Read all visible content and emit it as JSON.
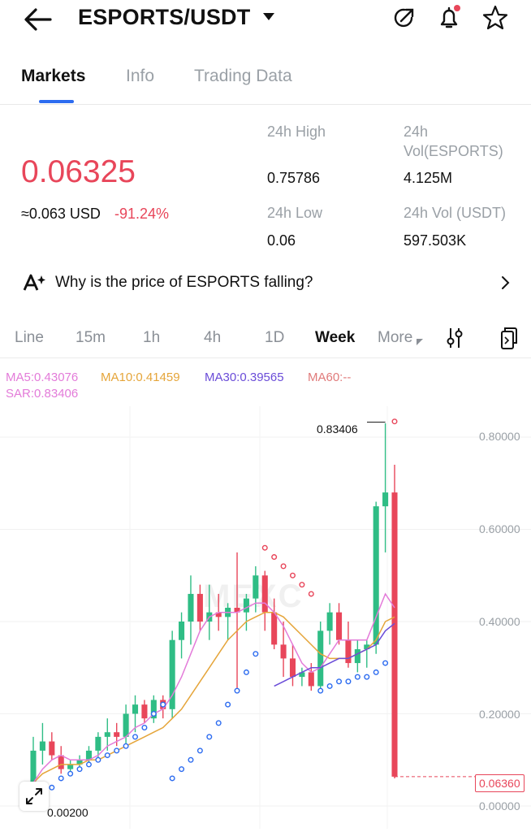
{
  "header": {
    "pair": "ESPORTS/USDT"
  },
  "tabs": [
    {
      "label": "Markets"
    },
    {
      "label": "Info"
    },
    {
      "label": "Trading Data"
    }
  ],
  "price": {
    "last": "0.06325",
    "usd": "≈0.063 USD",
    "change": "-91.24%",
    "color_down": "#e8465a"
  },
  "stats": {
    "high_label": "24h High",
    "high_value": "0.75786",
    "vol_esports_label_1": "24h",
    "vol_esports_label_2": "Vol(ESPORTS)",
    "vol_esports_value": "4.125M",
    "low_label": "24h Low",
    "low_value": "0.06",
    "vol_usdt_label": "24h Vol (USDT)",
    "vol_usdt_value": "597.503K"
  },
  "why": {
    "text": "Why is the price of ESPORTS falling?"
  },
  "chart_tabs": [
    {
      "label": "Line"
    },
    {
      "label": "15m"
    },
    {
      "label": "1h"
    },
    {
      "label": "4h"
    },
    {
      "label": "1D"
    },
    {
      "label": "Week"
    },
    {
      "label": "More"
    }
  ],
  "legend": {
    "ma5": "MA5:0.43076",
    "ma10": "MA10:0.41459",
    "ma30": "MA30:0.39565",
    "ma60": "MA60:--",
    "sar": "SAR:0.83406",
    "ma5_color": "#e37bd9",
    "ma10_color": "#e5a53a",
    "ma30_color": "#6a4cd8",
    "ma60_color": "#e07a7a"
  },
  "watermark": "MEXC",
  "chart_data": {
    "type": "candlestick",
    "y_ticks": [
      "0.80000",
      "0.60000",
      "0.40000",
      "0.20000",
      "0.00000"
    ],
    "ylim": [
      0,
      0.8
    ],
    "high_marker": "0.83406",
    "low_marker": "0.00200",
    "current_price": "0.06360",
    "up_color": "#2fbd85",
    "down_color": "#e8465a",
    "candles": [
      {
        "o": 0.02,
        "h": 0.15,
        "l": 0.002,
        "c": 0.12
      },
      {
        "o": 0.12,
        "h": 0.18,
        "l": 0.09,
        "c": 0.14
      },
      {
        "o": 0.14,
        "h": 0.16,
        "l": 0.1,
        "c": 0.11
      },
      {
        "o": 0.11,
        "h": 0.13,
        "l": 0.07,
        "c": 0.08
      },
      {
        "o": 0.08,
        "h": 0.1,
        "l": 0.07,
        "c": 0.09
      },
      {
        "o": 0.09,
        "h": 0.11,
        "l": 0.08,
        "c": 0.1
      },
      {
        "o": 0.1,
        "h": 0.13,
        "l": 0.09,
        "c": 0.12
      },
      {
        "o": 0.12,
        "h": 0.16,
        "l": 0.1,
        "c": 0.15
      },
      {
        "o": 0.15,
        "h": 0.19,
        "l": 0.12,
        "c": 0.16
      },
      {
        "o": 0.16,
        "h": 0.18,
        "l": 0.13,
        "c": 0.15
      },
      {
        "o": 0.15,
        "h": 0.22,
        "l": 0.13,
        "c": 0.2
      },
      {
        "o": 0.2,
        "h": 0.24,
        "l": 0.16,
        "c": 0.22
      },
      {
        "o": 0.22,
        "h": 0.23,
        "l": 0.18,
        "c": 0.19
      },
      {
        "o": 0.19,
        "h": 0.24,
        "l": 0.18,
        "c": 0.23
      },
      {
        "o": 0.23,
        "h": 0.24,
        "l": 0.19,
        "c": 0.21
      },
      {
        "o": 0.21,
        "h": 0.38,
        "l": 0.19,
        "c": 0.36
      },
      {
        "o": 0.36,
        "h": 0.42,
        "l": 0.32,
        "c": 0.4
      },
      {
        "o": 0.4,
        "h": 0.5,
        "l": 0.35,
        "c": 0.46
      },
      {
        "o": 0.46,
        "h": 0.48,
        "l": 0.38,
        "c": 0.4
      },
      {
        "o": 0.4,
        "h": 0.48,
        "l": 0.36,
        "c": 0.42
      },
      {
        "o": 0.42,
        "h": 0.46,
        "l": 0.38,
        "c": 0.41
      },
      {
        "o": 0.41,
        "h": 0.44,
        "l": 0.36,
        "c": 0.43
      },
      {
        "o": 0.43,
        "h": 0.55,
        "l": 0.25,
        "c": 0.42
      },
      {
        "o": 0.42,
        "h": 0.46,
        "l": 0.38,
        "c": 0.45
      },
      {
        "o": 0.45,
        "h": 0.52,
        "l": 0.42,
        "c": 0.5
      },
      {
        "o": 0.5,
        "h": 0.51,
        "l": 0.38,
        "c": 0.42
      },
      {
        "o": 0.42,
        "h": 0.45,
        "l": 0.34,
        "c": 0.35
      },
      {
        "o": 0.35,
        "h": 0.4,
        "l": 0.28,
        "c": 0.32
      },
      {
        "o": 0.32,
        "h": 0.35,
        "l": 0.26,
        "c": 0.28
      },
      {
        "o": 0.28,
        "h": 0.3,
        "l": 0.26,
        "c": 0.29
      },
      {
        "o": 0.29,
        "h": 0.31,
        "l": 0.25,
        "c": 0.26
      },
      {
        "o": 0.26,
        "h": 0.4,
        "l": 0.25,
        "c": 0.38
      },
      {
        "o": 0.38,
        "h": 0.44,
        "l": 0.35,
        "c": 0.42
      },
      {
        "o": 0.42,
        "h": 0.44,
        "l": 0.35,
        "c": 0.36
      },
      {
        "o": 0.36,
        "h": 0.4,
        "l": 0.3,
        "c": 0.31
      },
      {
        "o": 0.31,
        "h": 0.36,
        "l": 0.29,
        "c": 0.34
      },
      {
        "o": 0.34,
        "h": 0.36,
        "l": 0.3,
        "c": 0.35
      },
      {
        "o": 0.35,
        "h": 0.66,
        "l": 0.33,
        "c": 0.65
      },
      {
        "o": 0.65,
        "h": 0.83,
        "l": 0.55,
        "c": 0.68
      },
      {
        "o": 0.68,
        "h": 0.74,
        "l": 0.06,
        "c": 0.0636
      }
    ],
    "ma5": [
      0.05,
      0.08,
      0.1,
      0.11,
      0.1,
      0.1,
      0.1,
      0.11,
      0.13,
      0.14,
      0.15,
      0.17,
      0.18,
      0.2,
      0.21,
      0.24,
      0.28,
      0.33,
      0.38,
      0.41,
      0.42,
      0.42,
      0.42,
      0.43,
      0.44,
      0.44,
      0.42,
      0.39,
      0.35,
      0.31,
      0.29,
      0.3,
      0.33,
      0.36,
      0.36,
      0.36,
      0.36,
      0.41,
      0.46,
      0.43
    ],
    "ma10": [
      0.05,
      0.07,
      0.08,
      0.09,
      0.09,
      0.09,
      0.1,
      0.1,
      0.11,
      0.12,
      0.13,
      0.14,
      0.15,
      0.16,
      0.17,
      0.19,
      0.21,
      0.24,
      0.27,
      0.3,
      0.33,
      0.36,
      0.38,
      0.4,
      0.41,
      0.42,
      0.42,
      0.41,
      0.39,
      0.37,
      0.35,
      0.33,
      0.32,
      0.32,
      0.32,
      0.33,
      0.34,
      0.36,
      0.4,
      0.41
    ],
    "ma30": [
      null,
      null,
      null,
      null,
      null,
      null,
      null,
      null,
      null,
      null,
      null,
      null,
      null,
      null,
      null,
      null,
      null,
      null,
      null,
      null,
      null,
      null,
      null,
      null,
      null,
      null,
      0.26,
      0.27,
      0.28,
      0.29,
      0.3,
      0.3,
      0.31,
      0.32,
      0.32,
      0.33,
      0.34,
      0.35,
      0.38,
      0.396
    ],
    "sar": [
      0.002,
      0.02,
      0.04,
      0.06,
      0.07,
      0.08,
      0.09,
      0.1,
      0.11,
      0.12,
      0.13,
      0.15,
      0.17,
      0.2,
      0.22,
      0.06,
      0.08,
      0.1,
      0.12,
      0.15,
      0.18,
      0.22,
      0.25,
      0.29,
      0.33,
      0.56,
      0.54,
      0.52,
      0.5,
      0.48,
      0.46,
      0.25,
      0.26,
      0.27,
      0.27,
      0.28,
      0.28,
      0.29,
      0.31,
      0.834
    ]
  }
}
